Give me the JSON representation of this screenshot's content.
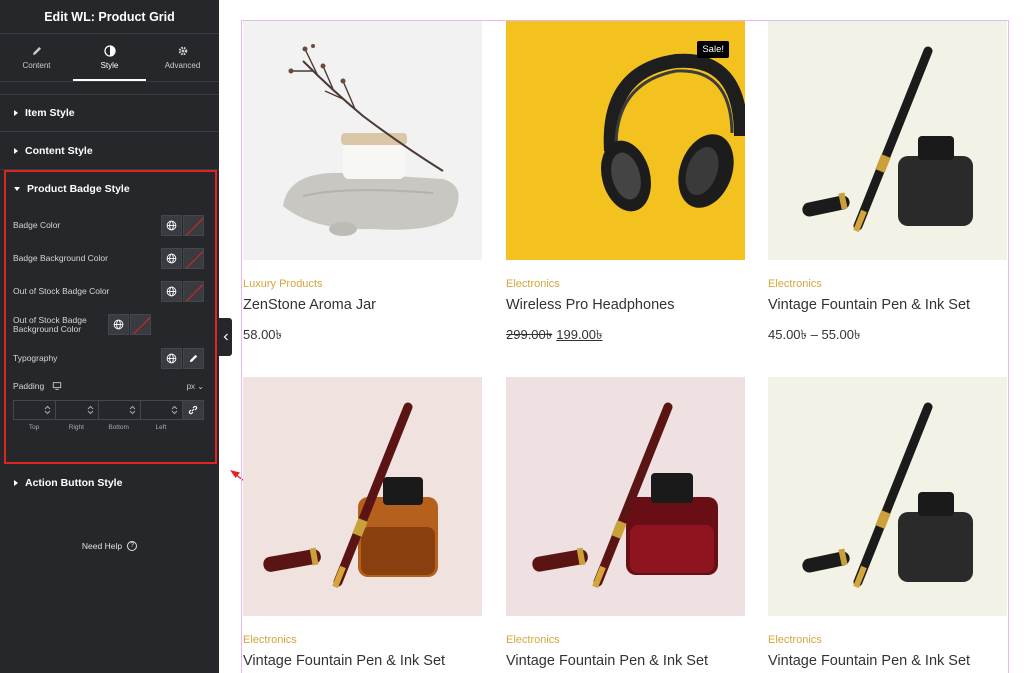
{
  "sidebar": {
    "title": "Edit WL: Product Grid",
    "tabs": [
      {
        "label": "Content",
        "icon": "pencil-icon"
      },
      {
        "label": "Style",
        "icon": "half-circle-icon"
      },
      {
        "label": "Advanced",
        "icon": "gear-icon"
      }
    ],
    "sections": {
      "item_style": "Item Style",
      "content_style": "Content Style",
      "badge_style": "Product Badge Style",
      "action_style": "Action Button Style"
    },
    "controls": [
      {
        "label": "Badge Color",
        "type": "color"
      },
      {
        "label": "Badge Background Color",
        "type": "color"
      },
      {
        "label": "Out of Stock Badge Color",
        "type": "color"
      },
      {
        "label": "Out of Stock Badge Background Color",
        "type": "color"
      },
      {
        "label": "Typography",
        "type": "typography"
      }
    ],
    "padding": {
      "label": "Padding",
      "unit": "px",
      "sides": [
        "Top",
        "Right",
        "Bottom",
        "Left"
      ]
    },
    "need_help": "Need Help",
    "help_icon": "?"
  },
  "products": [
    {
      "category": "Luxury Products",
      "name": "ZenStone Aroma Jar",
      "price": "58.00৳",
      "old_price": "",
      "badge": ""
    },
    {
      "category": "Electronics",
      "name": "Wireless Pro Headphones",
      "price": "199.00৳",
      "old_price": "299.00৳",
      "badge": "Sale!"
    },
    {
      "category": "Electronics",
      "name": "Vintage Fountain Pen & Ink Set",
      "price": "45.00৳ – 55.00৳",
      "old_price": "",
      "badge": ""
    },
    {
      "category": "Electronics",
      "name": "Vintage Fountain Pen & Ink Set",
      "price": "",
      "old_price": "",
      "badge": ""
    },
    {
      "category": "Electronics",
      "name": "Vintage Fountain Pen & Ink Set",
      "price": "",
      "old_price": "",
      "badge": ""
    },
    {
      "category": "Electronics",
      "name": "Vintage Fountain Pen & Ink Set",
      "price": "",
      "old_price": "",
      "badge": ""
    }
  ],
  "colors": {
    "sidebar_bg": "#26272b",
    "highlight": "#e02424",
    "category": "#d4a63a",
    "grid_outline": "#e6b8ef"
  }
}
